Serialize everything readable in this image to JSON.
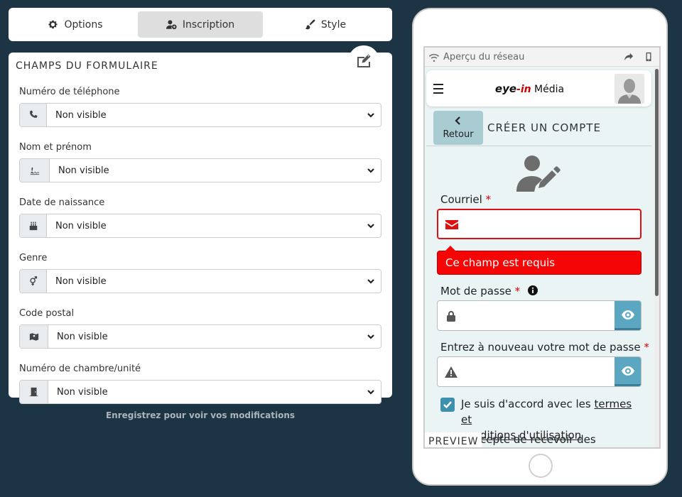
{
  "tabs": [
    {
      "label": "Options",
      "icon": "gear-icon"
    },
    {
      "label": "Inscription",
      "icon": "user-plus-icon",
      "active": true
    },
    {
      "label": "Style",
      "icon": "brush-icon"
    }
  ],
  "fields_panel": {
    "title": "CHAMPS DU FORMULAIRE",
    "fields": [
      {
        "label": "Numéro de téléphone",
        "icon": "phone-icon",
        "value": "Non visible"
      },
      {
        "label": "Nom et prénom",
        "icon": "signature-icon",
        "value": "Non visible"
      },
      {
        "label": "Date de naissance",
        "icon": "birthday-cake-icon",
        "value": "Non visible"
      },
      {
        "label": "Genre",
        "icon": "gender-icon",
        "value": "Non visible"
      },
      {
        "label": "Code postal",
        "icon": "map-icon",
        "value": "Non visible"
      },
      {
        "label": "Numéro de chambre/unité",
        "icon": "door-icon",
        "value": "Non visible"
      }
    ]
  },
  "save_hint": "Enregistrez pour voir vos modifications",
  "phone": {
    "network_label": "Aperçu du réseau",
    "brand": {
      "eye": "eye",
      "dash": "-",
      "in": "in",
      "media": "Média"
    },
    "back_label": "Retour",
    "form_title": "CRÉER UN COMPTE",
    "email_label": "Courriel",
    "required_mark": "*",
    "error_message": "Ce champ est requis",
    "password_label": "Mot de passe",
    "password_confirm_label": "Entrez à nouveau votre mot de passe",
    "terms_prefix": "Je suis d'accord avec les",
    "terms_link1": "termes et",
    "terms_link2": "conditions d'utilisation",
    "second_consent": "cepte de recevoir des",
    "preview_label": "PREVIEW"
  },
  "colors": {
    "background": "#1c3444",
    "error": "#f50505",
    "accent": "#5ba6c0",
    "checkbox": "#3f8fae"
  }
}
